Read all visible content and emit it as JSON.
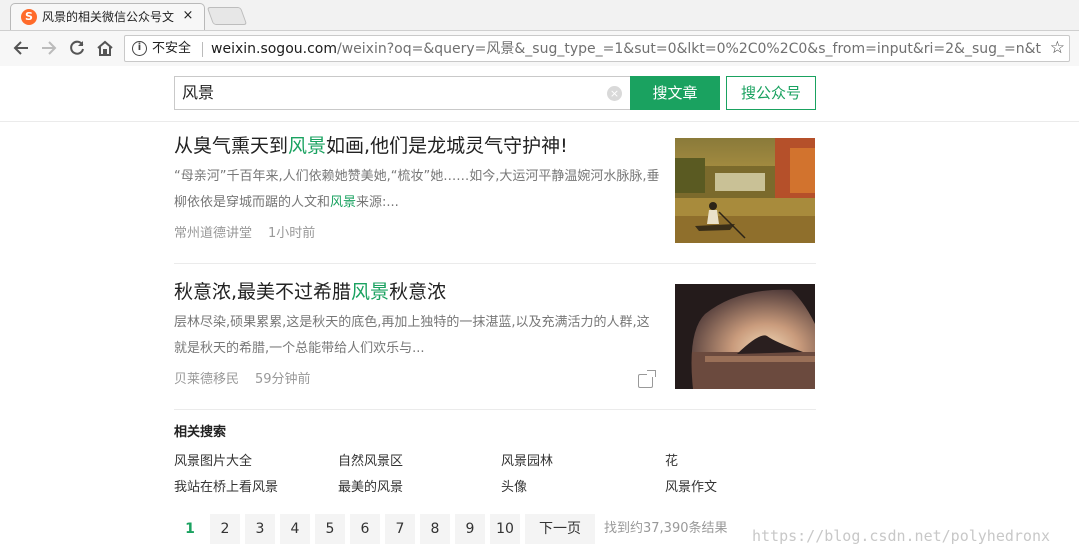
{
  "browser": {
    "tab_title": "风景的相关微信公众号文",
    "tab_close": "×",
    "favicon_letter": "S",
    "insecure_label": "不安全",
    "url_host": "weixin.sogou.com",
    "url_path": "/weixin?oq=&query=风景&_sug_type_=1&sut=0&lkt=0%2C0%2C0&s_from=input&ri=2&_sug_=n&typ...",
    "icons": [
      "back-icon",
      "forward-icon",
      "reload-icon",
      "home-icon",
      "info-icon",
      "bookmark-star-icon"
    ]
  },
  "search": {
    "query": "风景",
    "clear": "×",
    "search_articles": "搜文章",
    "search_accounts": "搜公众号",
    "accent_color": "#1aa260"
  },
  "results": [
    {
      "title_pre": "从臭气熏天到",
      "title_hl": "风景",
      "title_post": "如画,他们是龙城灵气守护神!",
      "summary_pre": "“母亲河”千百年来,人们依赖她赞美她,“梳妆”她……如今,大运河平静温婉河水脉脉,垂柳依依是穿城而踞的人文和",
      "summary_hl": "风景",
      "summary_post": "来源:...",
      "account": "常州道德讲堂",
      "time": "1小时前",
      "thumbnail": "rowing-boat-autumn-lake-photo"
    },
    {
      "title_pre": "秋意浓,最美不过希腊",
      "title_hl": "风景",
      "title_post": "秋意浓",
      "summary_pre": "层林尽染,硕果累累,这是秋天的底色,再加上独特的一抹湛蓝,以及充满活力的人群,这就是秋天的希腊,一个总能带给人们欢乐与...",
      "summary_hl": "",
      "summary_post": "",
      "account": "贝莱德移民",
      "time": "59分钟前",
      "thumbnail": "greek-island-sunset-photo"
    }
  ],
  "related": {
    "heading": "相关搜索",
    "items": [
      "风景图片大全",
      "自然风景区",
      "风景园林",
      "花",
      "我站在桥上看风景",
      "最美的风景",
      "头像",
      "风景作文"
    ]
  },
  "pagination": {
    "pages": [
      "1",
      "2",
      "3",
      "4",
      "5",
      "6",
      "7",
      "8",
      "9",
      "10"
    ],
    "current": "1",
    "next": "下一页",
    "count": "找到约37,390条结果"
  },
  "watermark": "https://blog.csdn.net/polyhedronx"
}
